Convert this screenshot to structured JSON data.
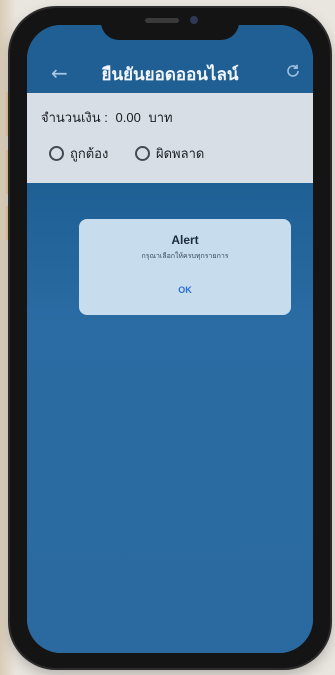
{
  "app": {
    "title": "ยืนยันยอดออนไลน์"
  },
  "form": {
    "amount_label": "จำนวนเงิน :",
    "amount_value": "0.00",
    "amount_unit": "บาท",
    "options": [
      {
        "label": "ถูกต้อง",
        "selected": false
      },
      {
        "label": "ผิดพลาด",
        "selected": false
      }
    ]
  },
  "alert": {
    "title": "Alert",
    "message": "กรุณาเลือกให้ครบทุกรายการ",
    "ok_label": "OK"
  },
  "colors": {
    "accent": "#1f5f94",
    "alert_bg": "#c7dced",
    "ok_color": "#2d6fd0"
  },
  "icons": {
    "back": "arrow-left-icon",
    "refresh": "refresh-icon"
  }
}
